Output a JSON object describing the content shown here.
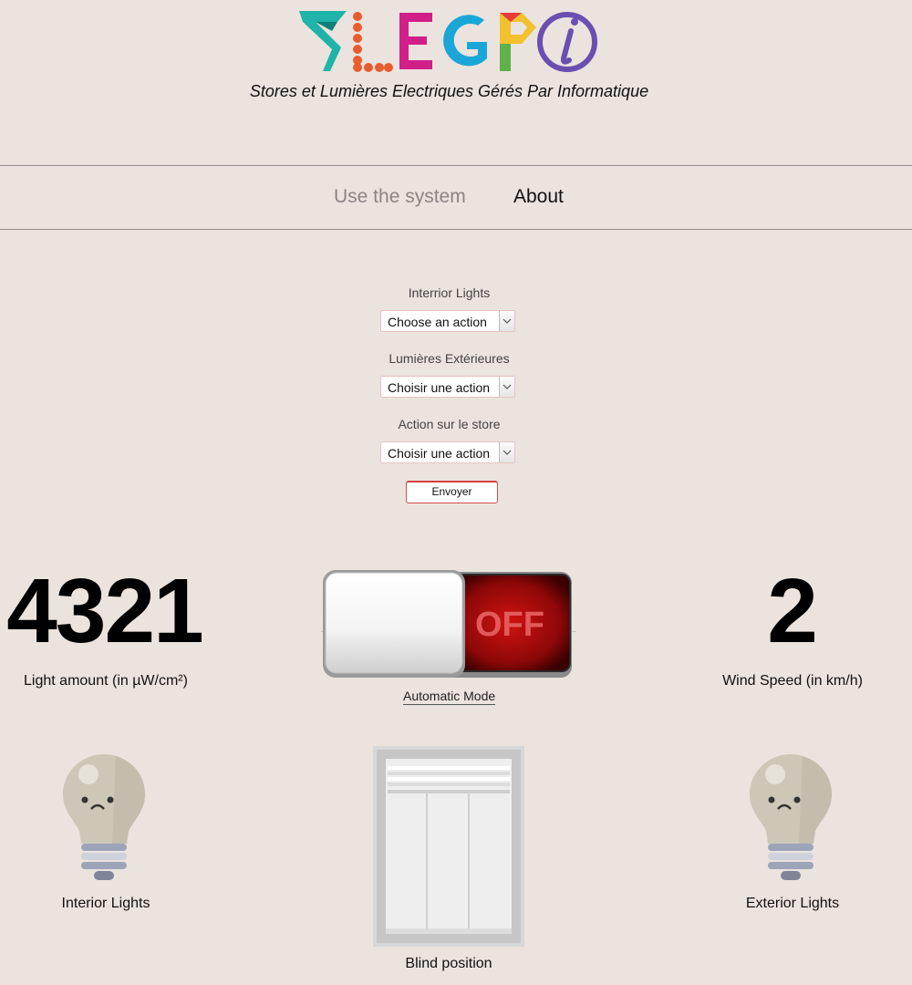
{
  "header": {
    "logo_text": "SLEGPI",
    "subtitle": "Stores et Lumières Electriques Gérés Par Informatique"
  },
  "nav": {
    "use_system": "Use the system",
    "about": "About"
  },
  "form": {
    "interior": {
      "label": "Interrior Lights",
      "value": "Choose an action"
    },
    "exterior": {
      "label": "Lumières Extérieures",
      "value": "Choisir une action"
    },
    "blind": {
      "label": "Action sur le store",
      "value": "Choisir une action"
    },
    "submit_label": "Envoyer"
  },
  "stats": {
    "light_value": "4321",
    "light_caption": "Light amount (in µW/cm²)",
    "wind_value": "2",
    "wind_caption": "Wind Speed (in km/h)"
  },
  "automatic_mode": {
    "state_label": "OFF",
    "caption": "Automatic Mode"
  },
  "lights": {
    "interior_caption": "Interior Lights",
    "exterior_caption": "Exterior Lights"
  },
  "blind": {
    "caption": "Blind position"
  },
  "colors": {
    "background": "#ebe3de",
    "toggle_off_red": "#a70c0c",
    "bulb_off": "#cdc7b8"
  }
}
